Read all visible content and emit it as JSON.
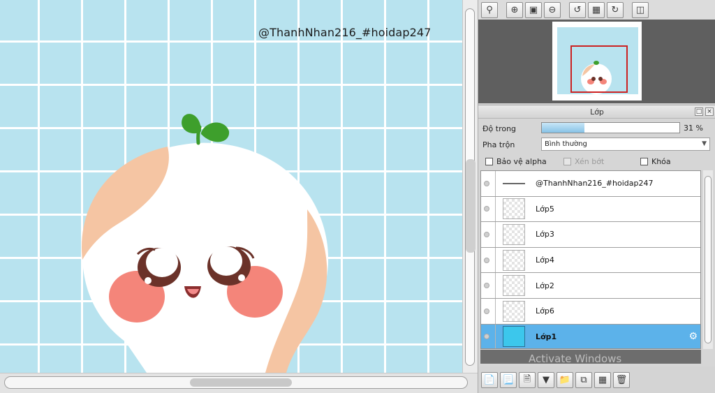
{
  "canvas": {
    "watermark": "@ThanhNhan216_#hoidap247",
    "grid_color": "#b8e3ef"
  },
  "nav_toolbar": {
    "icons": [
      "zoom-fit-icon",
      "zoom-in-icon",
      "fit-window-icon",
      "zoom-out-icon",
      "rotate-left-icon",
      "actual-size-icon",
      "rotate-right-icon",
      "flip-icon"
    ]
  },
  "layer_panel": {
    "title": "Lớp",
    "opacity_label": "Độ trong",
    "opacity_value": "31 %",
    "opacity_percent": 31,
    "blend_label": "Pha trộn",
    "blend_value": "Bình thường",
    "protect_alpha_label": "Bảo vệ alpha",
    "clipping_label": "Xén bớt",
    "lock_label": "Khóa",
    "layers": [
      {
        "name": "@ThanhNhan216_#hoidap247",
        "type": "text",
        "selected": false
      },
      {
        "name": "Lớp5",
        "type": "raster",
        "selected": false
      },
      {
        "name": "Lớp3",
        "type": "raster",
        "selected": false
      },
      {
        "name": "Lớp4",
        "type": "raster",
        "selected": false
      },
      {
        "name": "Lớp2",
        "type": "raster",
        "selected": false
      },
      {
        "name": "Lớp6",
        "type": "raster",
        "selected": false
      },
      {
        "name": "Lớp1",
        "type": "raster",
        "selected": true
      }
    ],
    "watermark_overlay": "Activate Windows"
  }
}
